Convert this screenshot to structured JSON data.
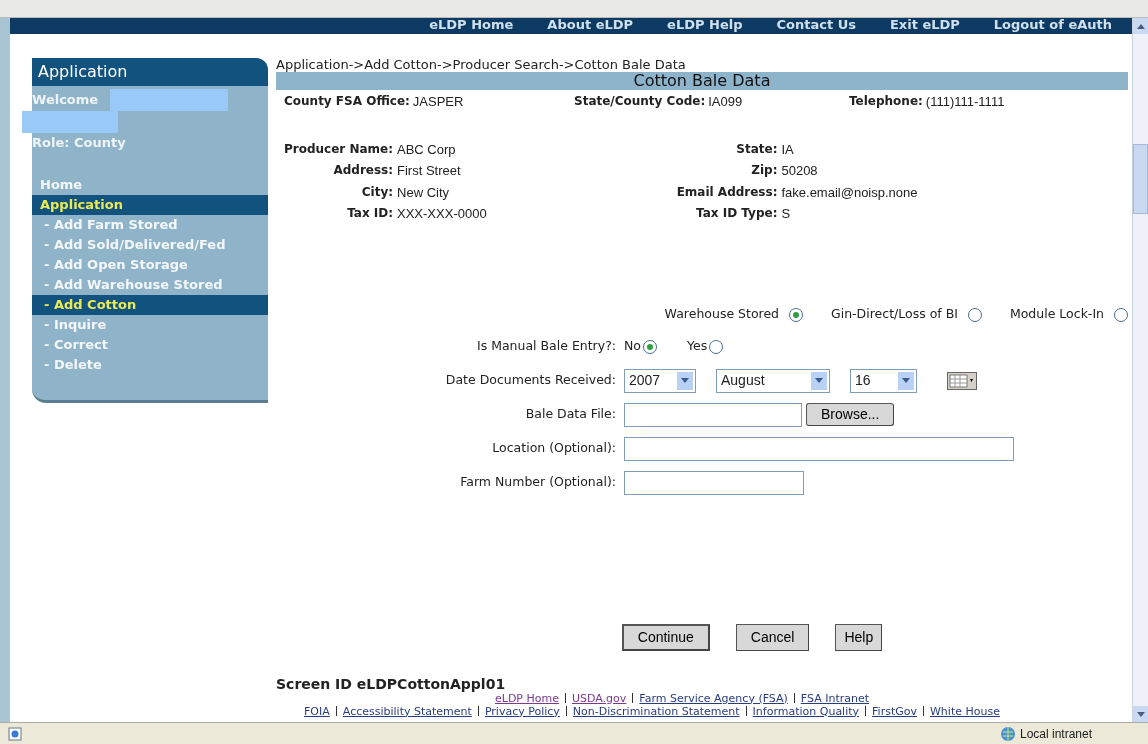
{
  "nav_links": [
    "eLDP Home",
    "About eLDP",
    "eLDP Help",
    "Contact Us",
    "Exit eLDP",
    "Logout of eAuth"
  ],
  "sidebar": {
    "title": "Application",
    "welcome": "Welcome",
    "role": "Role: County",
    "items": [
      {
        "label": "Home",
        "selected": false
      },
      {
        "label": "Application",
        "selected": true,
        "children": [
          {
            "label": "- Add Farm Stored",
            "selected": false
          },
          {
            "label": "- Add Sold/Delivered/Fed",
            "selected": false
          },
          {
            "label": "- Add Open Storage",
            "selected": false
          },
          {
            "label": "- Add Warehouse Stored",
            "selected": false
          },
          {
            "label": "- Add Cotton",
            "selected": true
          },
          {
            "label": "- Inquire",
            "selected": false
          },
          {
            "label": "- Correct",
            "selected": false
          },
          {
            "label": "- Delete",
            "selected": false
          }
        ]
      }
    ]
  },
  "breadcrumb": "Application->Add Cotton->Producer Search->Cotton Bale Data",
  "page_title": "Cotton Bale Data",
  "office_info": [
    {
      "label": "County FSA Office:",
      "value": "JASPER"
    },
    {
      "label": "State/County Code:",
      "value": "IA099"
    },
    {
      "label": "Telephone:",
      "value": "(111)111-1111"
    }
  ],
  "producer_left": [
    {
      "label": "Producer Name:",
      "value": "ABC Corp"
    },
    {
      "label": "Address:",
      "value": "First Street"
    },
    {
      "label": "City:",
      "value": "New City"
    },
    {
      "label": "Tax ID:",
      "value": "XXX-XXX-0000"
    }
  ],
  "producer_right": [
    {
      "label": "State:",
      "value": "IA"
    },
    {
      "label": "Zip:",
      "value": "50208"
    },
    {
      "label": "Email Address:",
      "value": "fake.email@noisp.none"
    },
    {
      "label": "Tax ID Type:",
      "value": "S"
    }
  ],
  "storage_type": [
    {
      "label": "Warehouse Stored",
      "selected": true
    },
    {
      "label": "Gin-Direct/Loss of BI",
      "selected": false
    },
    {
      "label": "Module Lock-In",
      "selected": false
    }
  ],
  "manual_entry": {
    "label": "Is Manual Bale Entry?:",
    "options": [
      {
        "label": "No",
        "selected": true
      },
      {
        "label": "Yes",
        "selected": false
      }
    ]
  },
  "date_received": {
    "label": "Date Documents Received:",
    "year": "2007",
    "month": "August",
    "day": "16"
  },
  "bale_file": {
    "label": "Bale Data File:",
    "button": "Browse..."
  },
  "location": {
    "label": "Location (Optional):"
  },
  "farm_number": {
    "label": "Farm Number (Optional):"
  },
  "buttons": [
    "Continue",
    "Cancel",
    "Help"
  ],
  "screen_id": "Screen ID eLDPCottonAppl01",
  "footer_links_1": [
    "eLDP Home",
    "USDA.gov",
    "Farm Service Agency (FSA)",
    "FSA Intranet"
  ],
  "footer_links_2": [
    "FOIA",
    "Accessibility Statement",
    "Privacy Policy",
    "Non-Discrimination Statement",
    "Information Quality",
    "FirstGov",
    "White House"
  ],
  "status_bar": {
    "zone": "Local intranet"
  }
}
